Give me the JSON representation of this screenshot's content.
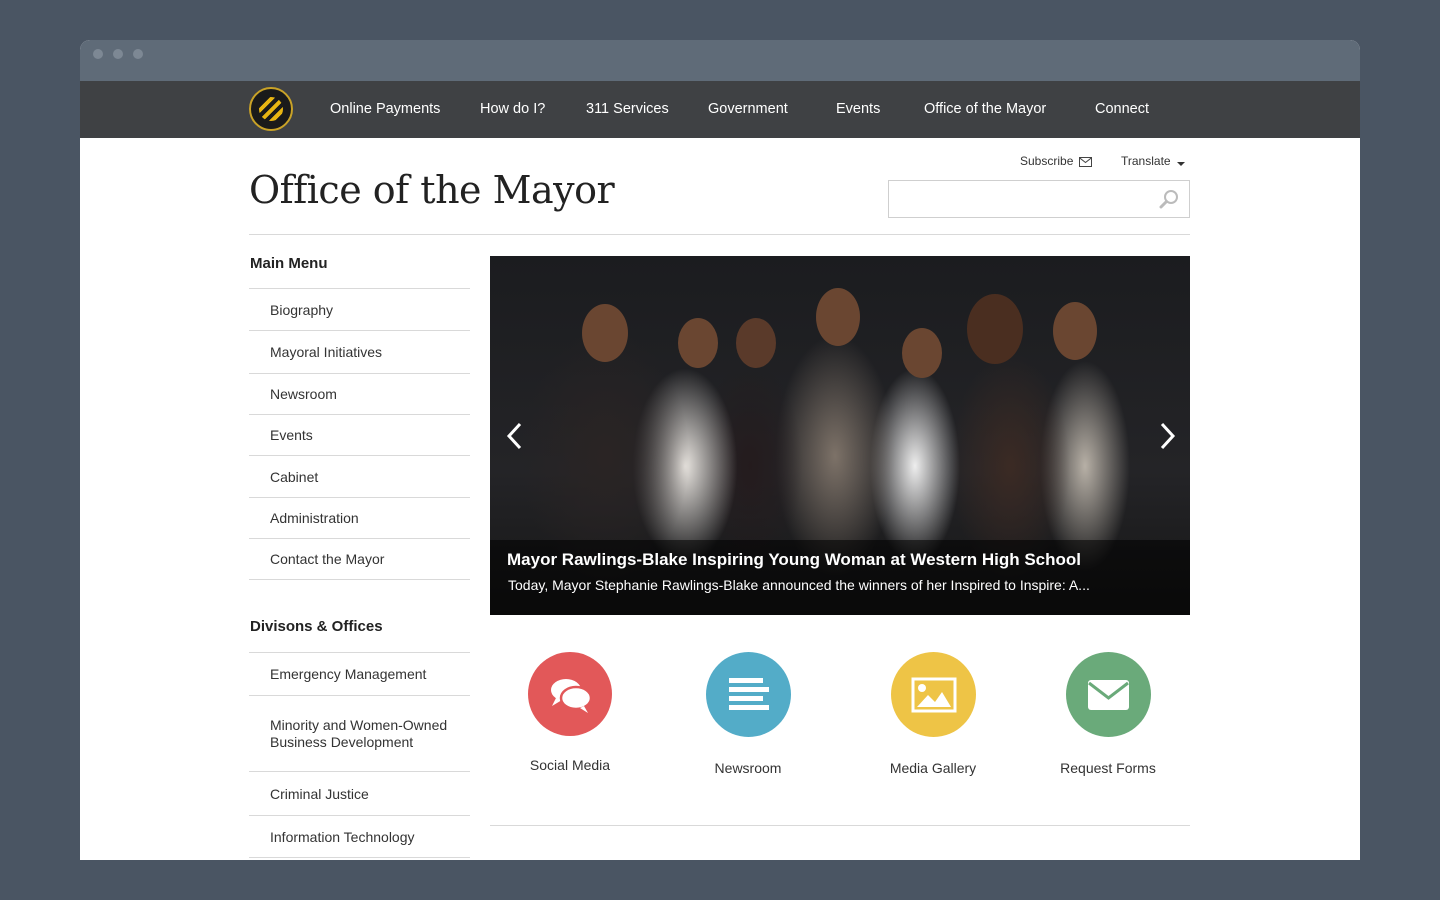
{
  "nav": {
    "items": [
      "Online Payments",
      "How do I?",
      "311 Services",
      "Government",
      "Events",
      "Office of the Mayor",
      "Connect"
    ]
  },
  "utility": {
    "subscribe": "Subscribe",
    "translate": "Translate"
  },
  "search": {
    "placeholder": ""
  },
  "page": {
    "title": "Office of the Mayor"
  },
  "sidebar": {
    "main_menu": {
      "heading": "Main Menu",
      "items": [
        "Biography",
        "Mayoral Initiatives",
        "Newsroom",
        "Events",
        "Cabinet",
        "Administration",
        "Contact the Mayor"
      ]
    },
    "divisions": {
      "heading": "Divisons & Offices",
      "items": [
        "Emergency Management",
        "Minority and Women-Owned Business Development",
        "Criminal Justice",
        "Information Technology"
      ]
    }
  },
  "hero": {
    "title": "Mayor Rawlings-Blake Inspiring Young Woman at Western High School",
    "text": "Today, Mayor Stephanie Rawlings-Blake announced the winners of her Inspired to Inspire: A..."
  },
  "features": [
    {
      "label": "Social Media",
      "color": "#e25859",
      "icon": "chat-bubbles-icon"
    },
    {
      "label": "Newsroom",
      "color": "#53acc8",
      "icon": "text-lines-icon"
    },
    {
      "label": "Media Gallery",
      "color": "#eec446",
      "icon": "image-icon"
    },
    {
      "label": "Request Forms",
      "color": "#6aaa7a",
      "icon": "envelope-icon"
    }
  ],
  "colors": {
    "background": "#4a5563",
    "navbar": "#3f4144",
    "titlebar": "#5f6b78"
  }
}
